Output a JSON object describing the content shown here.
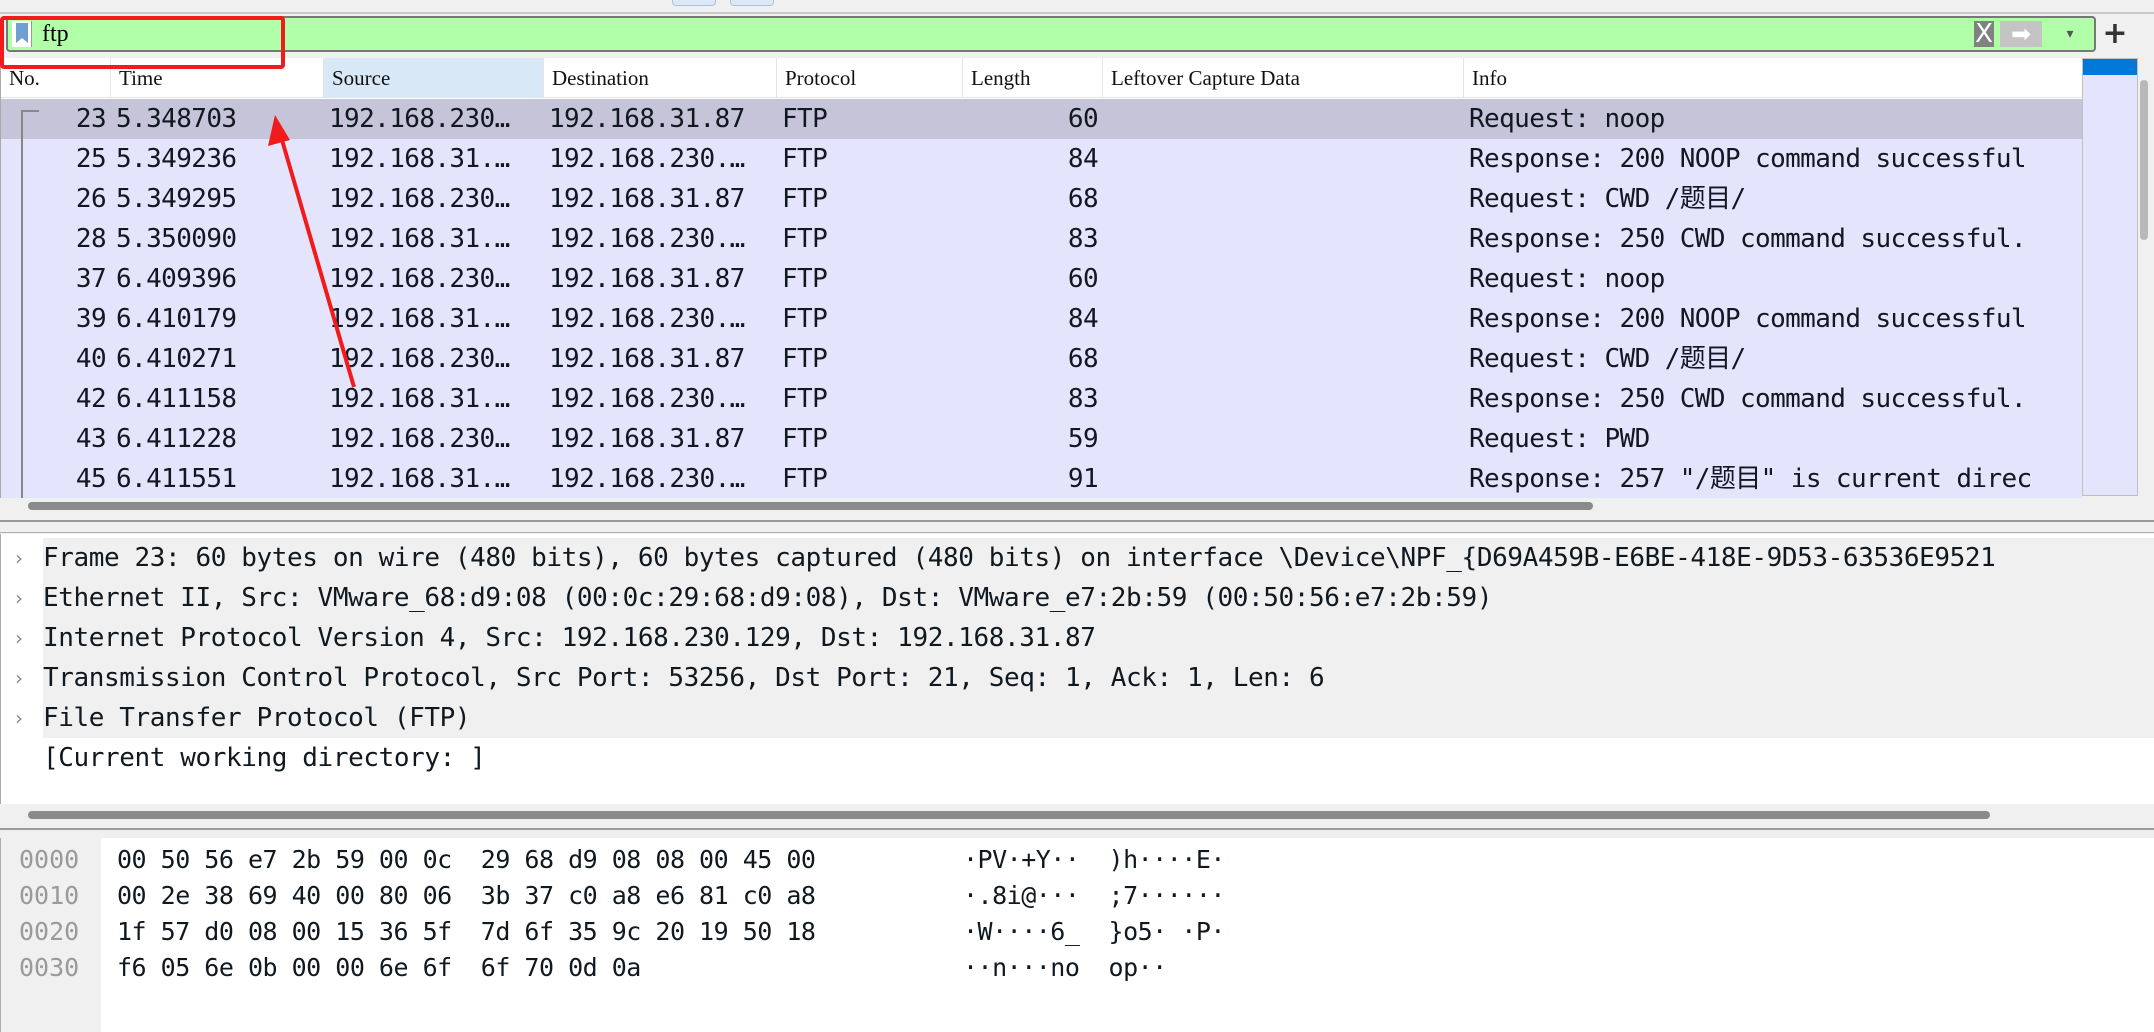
{
  "filter": {
    "value": "ftp",
    "clear_icon": "X",
    "apply_icon": "➡",
    "dropdown_icon": "▾",
    "add_icon": "+",
    "background": "#b2ffaa"
  },
  "columns": [
    "No.",
    "Time",
    "Source",
    "Destination",
    "Protocol",
    "Length",
    "Leftover Capture Data",
    "Info"
  ],
  "packets": [
    {
      "no": "23",
      "time": "5.348703",
      "src": "192.168.230…",
      "dst": "192.168.31.87",
      "proto": "FTP",
      "len": "60",
      "leftover": "",
      "info": "Request: noop",
      "selected": true
    },
    {
      "no": "25",
      "time": "5.349236",
      "src": "192.168.31.…",
      "dst": "192.168.230.…",
      "proto": "FTP",
      "len": "84",
      "leftover": "",
      "info": "Response: 200 NOOP command successful"
    },
    {
      "no": "26",
      "time": "5.349295",
      "src": "192.168.230…",
      "dst": "192.168.31.87",
      "proto": "FTP",
      "len": "68",
      "leftover": "",
      "info": "Request: CWD /题目/"
    },
    {
      "no": "28",
      "time": "5.350090",
      "src": "192.168.31.…",
      "dst": "192.168.230.…",
      "proto": "FTP",
      "len": "83",
      "leftover": "",
      "info": "Response: 250 CWD command successful."
    },
    {
      "no": "37",
      "time": "6.409396",
      "src": "192.168.230…",
      "dst": "192.168.31.87",
      "proto": "FTP",
      "len": "60",
      "leftover": "",
      "info": "Request: noop"
    },
    {
      "no": "39",
      "time": "6.410179",
      "src": "192.168.31.…",
      "dst": "192.168.230.…",
      "proto": "FTP",
      "len": "84",
      "leftover": "",
      "info": "Response: 200 NOOP command successful"
    },
    {
      "no": "40",
      "time": "6.410271",
      "src": "192.168.230…",
      "dst": "192.168.31.87",
      "proto": "FTP",
      "len": "68",
      "leftover": "",
      "info": "Request: CWD /题目/"
    },
    {
      "no": "42",
      "time": "6.411158",
      "src": "192.168.31.…",
      "dst": "192.168.230.…",
      "proto": "FTP",
      "len": "83",
      "leftover": "",
      "info": "Response: 250 CWD command successful."
    },
    {
      "no": "43",
      "time": "6.411228",
      "src": "192.168.230…",
      "dst": "192.168.31.87",
      "proto": "FTP",
      "len": "59",
      "leftover": "",
      "info": "Request: PWD"
    },
    {
      "no": "45",
      "time": "6.411551",
      "src": "192.168.31.…",
      "dst": "192.168.230.…",
      "proto": "FTP",
      "len": "91",
      "leftover": "",
      "info": "Response: 257 \"/题目\" is current direc"
    }
  ],
  "details": [
    {
      "text": "Frame 23: 60 bytes on wire (480 bits), 60 bytes captured (480 bits) on interface \\Device\\NPF_{D69A459B-E6BE-418E-9D53-63536E9521",
      "expandable": true
    },
    {
      "text": "Ethernet II, Src: VMware_68:d9:08 (00:0c:29:68:d9:08), Dst: VMware_e7:2b:59 (00:50:56:e7:2b:59)",
      "expandable": true
    },
    {
      "text": "Internet Protocol Version 4, Src: 192.168.230.129, Dst: 192.168.31.87",
      "expandable": true
    },
    {
      "text": "Transmission Control Protocol, Src Port: 53256, Dst Port: 21, Seq: 1, Ack: 1, Len: 6",
      "expandable": true
    },
    {
      "text": "File Transfer Protocol (FTP)",
      "expandable": true
    },
    {
      "text": "[Current working directory: ]",
      "expandable": false
    }
  ],
  "chevron_icon": "›",
  "hex": [
    {
      "offset": "0000",
      "bytes": "00 50 56 e7 2b 59 00 0c  29 68 d9 08 08 00 45 00",
      "ascii": "·PV·+Y··  )h····E·"
    },
    {
      "offset": "0010",
      "bytes": "00 2e 38 69 40 00 80 06  3b 37 c0 a8 e6 81 c0 a8",
      "ascii": "·.8i@···  ;7······"
    },
    {
      "offset": "0020",
      "bytes": "1f 57 d0 08 00 15 36 5f  7d 6f 35 9c 20 19 50 18",
      "ascii": "·W····6_  }o5· ·P·"
    },
    {
      "offset": "0030",
      "bytes": "f6 05 6e 0b 00 00 6e 6f  6f 70 0d 0a",
      "ascii": "··n···no  op··"
    }
  ],
  "colors": {
    "row": "#e4e4fc",
    "selected_row": "#c6c4d8",
    "annotation": "#f21b1b",
    "scroll_thumb": "#0078d7"
  }
}
